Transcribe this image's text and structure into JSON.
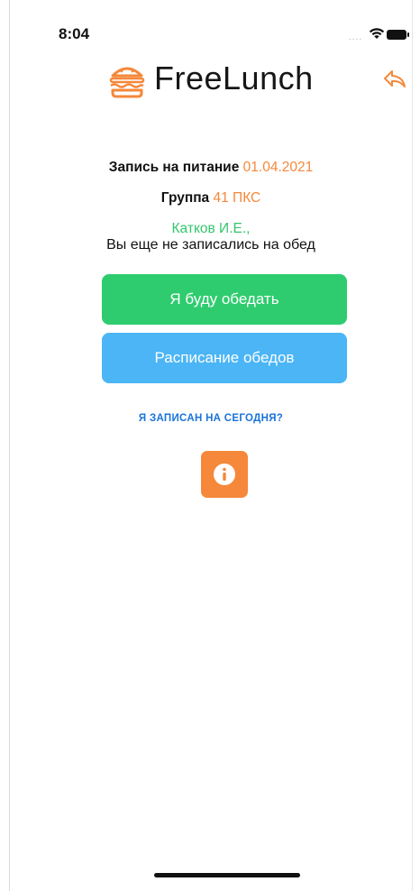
{
  "status_bar": {
    "time": "8:04",
    "signal_dots": "....",
    "icons": [
      "wifi-icon",
      "battery-icon"
    ]
  },
  "header": {
    "app_title": "FreeLunch",
    "logo_icon": "burger-icon",
    "back_icon": "back-arrow-icon"
  },
  "info": {
    "enrollment_label": "Запись на питание",
    "enrollment_date": "01.04.2021",
    "group_label": "Группа",
    "group_value": "41 ПКС",
    "student_name": "Катков И.Е.,",
    "status_message": "Вы еще не записались на обед"
  },
  "actions": {
    "lunch_button": "Я буду обедать",
    "schedule_button": "Расписание обедов",
    "today_link": "Я ЗАПИСАН НА СЕГОДНЯ?",
    "info_button_icon": "info-icon"
  },
  "colors": {
    "accent_orange": "#f5883a",
    "green": "#2fcc6f",
    "blue": "#4bb5f5",
    "link_blue": "#1a73d9",
    "name_green": "#33c66c"
  }
}
